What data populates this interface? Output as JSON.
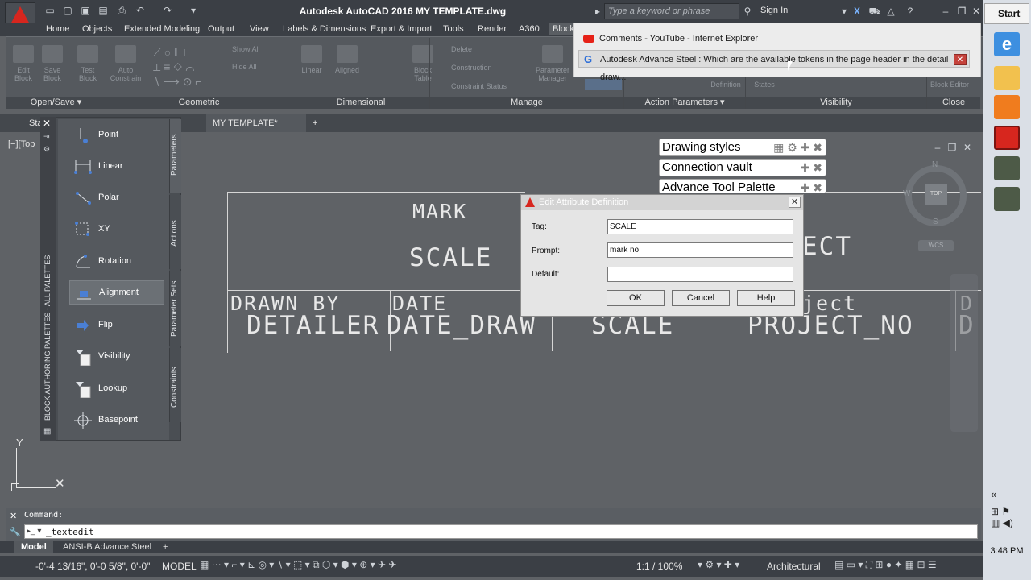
{
  "window": {
    "title": "Autodesk AutoCAD 2016   MY TEMPLATE.dwg",
    "search_placeholder": "Type a keyword or phrase",
    "signin": "Sign In"
  },
  "ribbon_tabs": [
    "Home",
    "Objects",
    "Extended Modeling",
    "Output",
    "View",
    "Labels & Dimensions",
    "Export & Import",
    "Tools",
    "Render",
    "A360",
    "Block"
  ],
  "ribbon": {
    "buttons": [
      {
        "label": "Edit Block"
      },
      {
        "label": "Save Block"
      },
      {
        "label": "Test Block"
      },
      {
        "label": "Auto Constrain"
      },
      {
        "label": "Linear"
      },
      {
        "label": "Aligned"
      },
      {
        "label": "Block Table"
      },
      {
        "label": "Parameter Manager"
      },
      {
        "label": "Show All"
      },
      {
        "label": "Hide All"
      },
      {
        "label": "Delete"
      },
      {
        "label": "Construction"
      },
      {
        "label": "Constraint Status"
      },
      {
        "label": "Definition"
      },
      {
        "label": "States"
      },
      {
        "label": "Block Editor"
      }
    ],
    "panels": [
      "Open/Save",
      "Geometric",
      "Dimensional",
      "Manage",
      "Action Parameters",
      "Visibility",
      "Close"
    ]
  },
  "popup": {
    "items": [
      {
        "label": "Comments - YouTube - Internet Explorer"
      },
      {
        "label": "Autodesk Advance Steel : Which are the available tokens in the page header in the detail draw..."
      }
    ]
  },
  "doc_tabs": [
    "Sta",
    "MY TEMPLATE*"
  ],
  "viewport_label": "[−][Top",
  "palette": {
    "title": "BLOCK AUTHORING PALETTES - ALL PALETTES",
    "side_tabs": [
      "Parameters",
      "Actions",
      "Parameter Sets",
      "Constraints"
    ],
    "items": [
      {
        "label": "Point"
      },
      {
        "label": "Linear"
      },
      {
        "label": "Polar"
      },
      {
        "label": "XY"
      },
      {
        "label": "Rotation"
      },
      {
        "label": "Alignment"
      },
      {
        "label": "Flip"
      },
      {
        "label": "Visibility"
      },
      {
        "label": "Lookup"
      },
      {
        "label": "Basepoint"
      }
    ]
  },
  "drawing": {
    "mark": "MARK",
    "scale": "SCALE",
    "ect": "ECT",
    "drawn_by": "DRAWN BY",
    "date": "DATE",
    "detailer": "DETAILER",
    "date_draw": "DATE_DRAW",
    "scale2": "SCALE",
    "project": "ject",
    "project_no": "PROJECT_NO",
    "d1": "D",
    "d2": "D"
  },
  "advance_steel": {
    "palettes": [
      "Drawing styles",
      "Connection vault",
      "Advance Tool Palette"
    ]
  },
  "viewcube": {
    "n": "N",
    "s": "S",
    "w": "W",
    "top": "TOP",
    "wcs": "WCS"
  },
  "dialog": {
    "title": "Edit Attribute Definition",
    "tag_label": "Tag:",
    "tag_value": "SCALE",
    "prompt_label": "Prompt:",
    "prompt_value": "mark no.",
    "default_label": "Default:",
    "default_value": "",
    "ok": "OK",
    "cancel": "Cancel",
    "help": "Help"
  },
  "command": {
    "history": "Command:",
    "input": "_textedit"
  },
  "layout_tabs": [
    "Model",
    "ANSI-B Advance Steel"
  ],
  "status": {
    "coords": "-0'-4 13/16\", 0'-0 5/8\", 0'-0\"",
    "model": "MODEL",
    "scale": "1:1 / 100%",
    "units": "Architectural"
  },
  "taskbar": {
    "start": "Start",
    "time": "3:48 PM"
  },
  "colors": {
    "autocad_red": "#d7261e",
    "ribbon_bg": "#55595e",
    "drawing_bg": "#5f6266"
  }
}
